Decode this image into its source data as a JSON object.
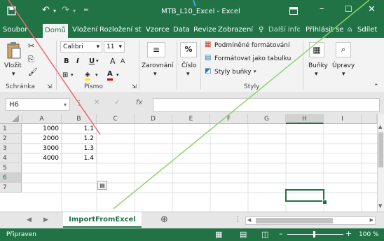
{
  "window": {
    "title": "MTB_L10_Excel - Excel"
  },
  "ribbon_tabs": [
    {
      "label": "Soubor",
      "active": false
    },
    {
      "label": "Domů",
      "active": true
    },
    {
      "label": "Vložení",
      "active": false
    },
    {
      "label": "Rozložení strá",
      "active": false
    },
    {
      "label": "Vzorce",
      "active": false
    },
    {
      "label": "Data",
      "active": false
    },
    {
      "label": "Revize",
      "active": false
    },
    {
      "label": "Zobrazení",
      "active": false
    },
    {
      "label": "Další info",
      "active": false
    }
  ],
  "account": {
    "signin": "Přihlásit se",
    "share": "Sdílet"
  },
  "ribbon": {
    "clipboard": {
      "paste": "Vložit",
      "group": "Schránka"
    },
    "font": {
      "name": "Calibri",
      "size": "11",
      "bold": "B",
      "italic": "I",
      "underline": "U",
      "grow": "A",
      "shrink": "A",
      "color_letter": "A",
      "group": "Písmo"
    },
    "alignment": {
      "label": "Zarovnání"
    },
    "number": {
      "label": "Číslo",
      "symbol": "%"
    },
    "styles": {
      "conditional": "Podmíněné formátování",
      "as_table": "Formátovat jako tabulku",
      "cell_styles": "Styly buňky",
      "group": "Styly"
    },
    "cells": {
      "label": "Buňky"
    },
    "editing": {
      "label": "Úpravy"
    }
  },
  "formula_bar": {
    "name_box": "H6",
    "fx": "fx",
    "value": ""
  },
  "grid": {
    "columns": [
      "A",
      "B",
      "C",
      "D",
      "E",
      "F",
      "G",
      "H",
      "I"
    ],
    "selected_column": "H",
    "rows": [
      "1",
      "2",
      "3",
      "4",
      "5",
      "6",
      "7"
    ],
    "selected_row": "6",
    "data": [
      [
        "1000",
        "1.1"
      ],
      [
        "2000",
        "1.2"
      ],
      [
        "3000",
        "1.3"
      ],
      [
        "4000",
        "1.4"
      ]
    ]
  },
  "sheets": [
    {
      "name": "ImportFromExcel",
      "active": true
    }
  ],
  "status": {
    "ready": "Připraven",
    "zoom": "100 %"
  },
  "colors": {
    "excel_green": "#217346",
    "annotation_red": "#e8697a",
    "annotation_green": "#8dd46a",
    "annotation_blue": "#4aa3e8"
  }
}
